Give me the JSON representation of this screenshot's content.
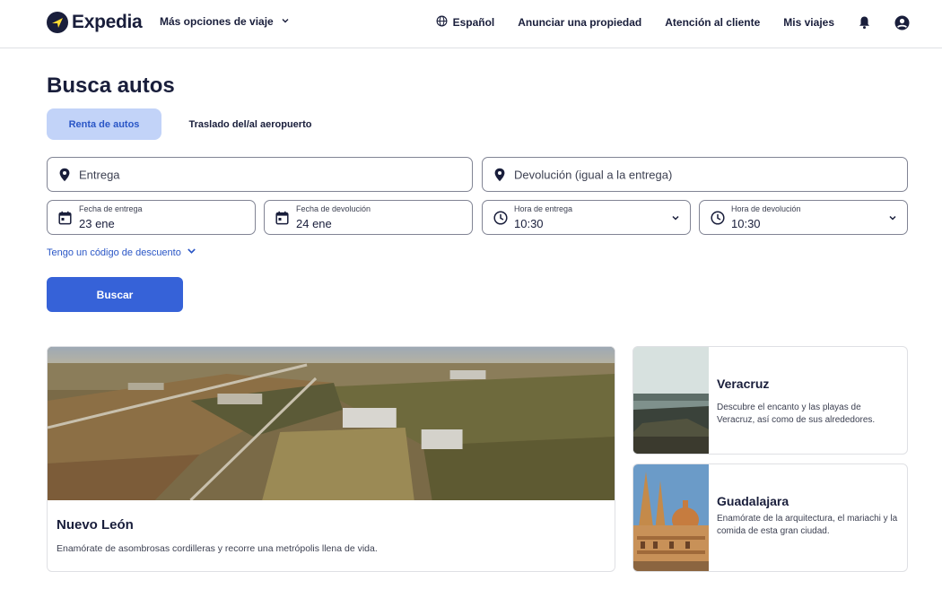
{
  "header": {
    "brand": "Expedia",
    "more_options": "Más opciones de viaje",
    "language": "Español",
    "list_property": "Anunciar una propiedad",
    "support": "Atención al cliente",
    "trips": "Mis viajes"
  },
  "page": {
    "title": "Busca autos"
  },
  "tabs": [
    {
      "label": "Renta de autos",
      "active": true
    },
    {
      "label": "Traslado del/al aeropuerto",
      "active": false
    }
  ],
  "form": {
    "pickup_placeholder": "Entrega",
    "dropoff_placeholder": "Devolución (igual a la entrega)",
    "pickup_date_label": "Fecha de entrega",
    "pickup_date_value": "23 ene",
    "dropoff_date_label": "Fecha de devolución",
    "dropoff_date_value": "24 ene",
    "pickup_time_label": "Hora de entrega",
    "pickup_time_value": "10:30",
    "dropoff_time_label": "Hora de devolución",
    "dropoff_time_value": "10:30",
    "discount_link": "Tengo un código de descuento",
    "search_button": "Buscar"
  },
  "destinations": [
    {
      "title": "Nuevo León",
      "description": "Enamórate de asombrosas cordilleras y recorre una metrópolis llena de vida."
    },
    {
      "title": "Veracruz",
      "description": "Descubre el encanto y las playas de Veracruz, así como de sus alrededores."
    },
    {
      "title": "Guadalajara",
      "description": "Enamórate de la arquitectura, el mariachi y la comida de esta gran ciudad."
    }
  ],
  "colors": {
    "brand_navy": "#191e3b",
    "primary_blue": "#3662d8",
    "tab_active_bg": "#c2d3f8",
    "link_blue": "#2a56c6"
  }
}
